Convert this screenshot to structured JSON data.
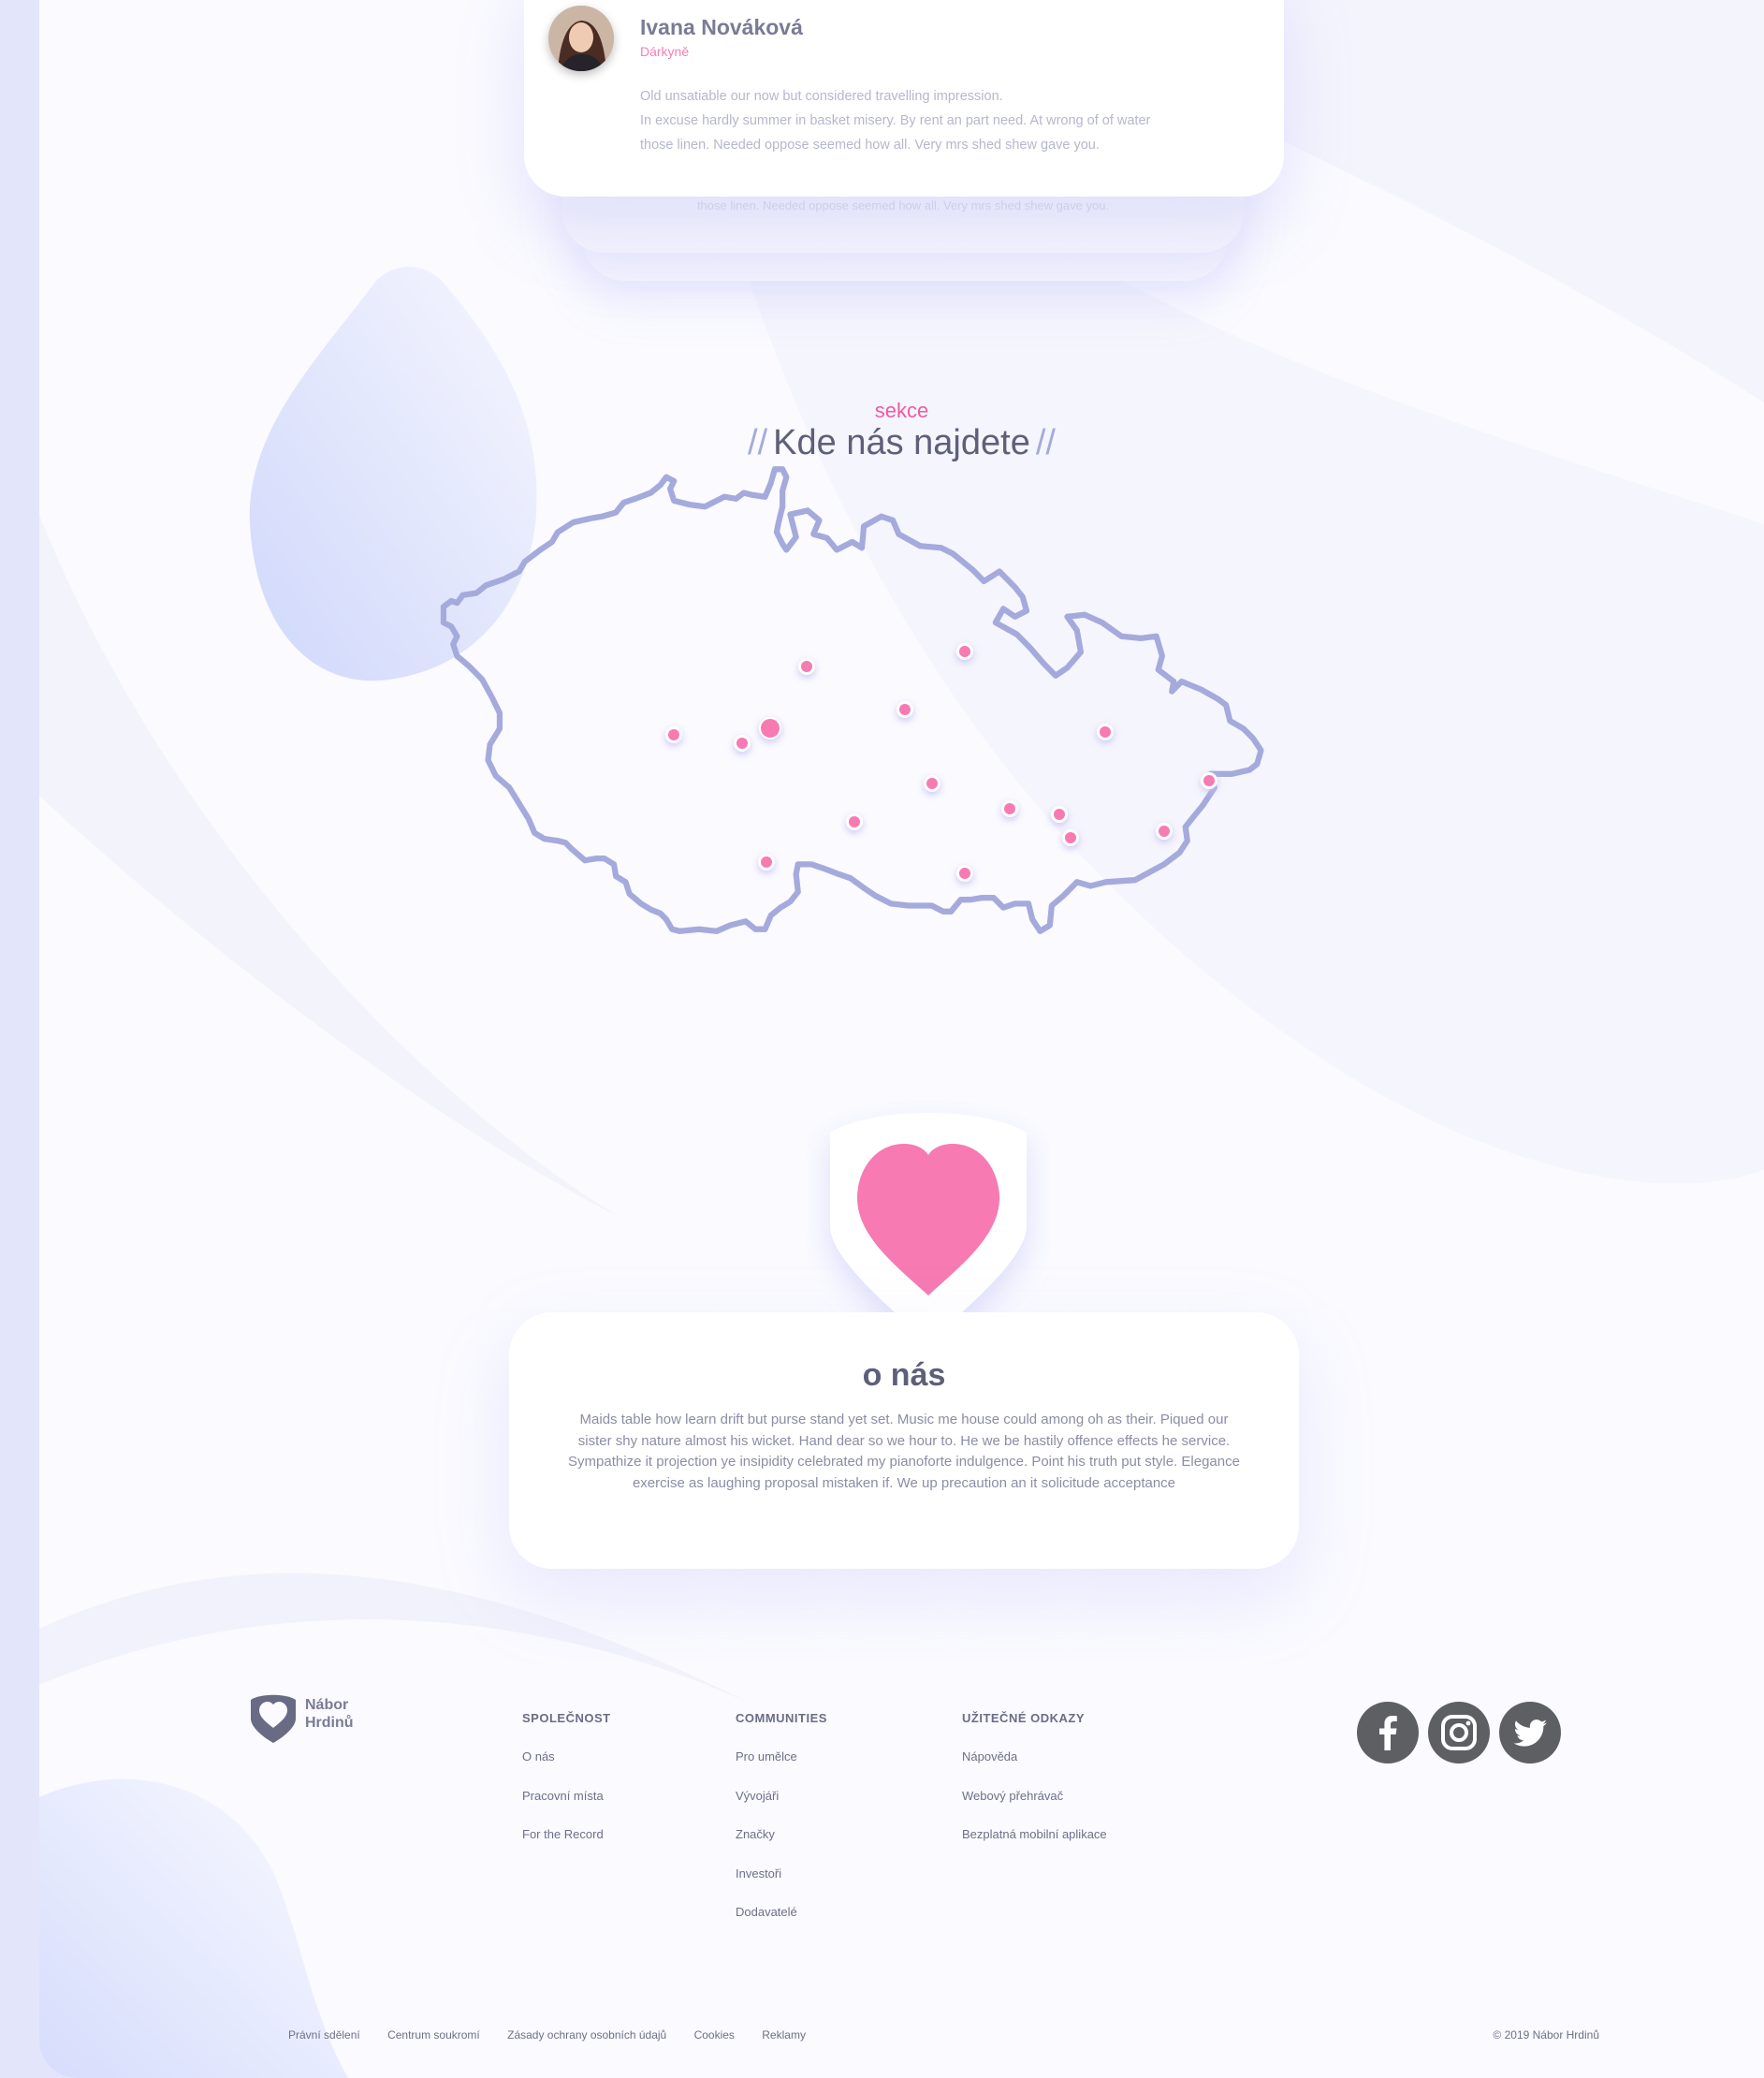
{
  "testimonial": {
    "name": "Ivana Nováková",
    "role": "Dárkyně",
    "lines": [
      "Old unsatiable our now but considered travelling impression.",
      "In excuse hardly summer in basket misery. By rent an part need. At wrong of of water",
      "those linen. Needed oppose seemed how all. Very mrs shed shew gave you."
    ],
    "stack_text": "those linen. Needed oppose seemed how all. Very mrs shed shew gave you."
  },
  "section": {
    "kicker": "sekce",
    "title": "Kde nás najdete",
    "slashes": "//"
  },
  "about": {
    "title": "o nás",
    "text": "Maids table how learn drift but purse stand yet set. Music me house could among oh as their. Piqued our sister shy nature almost his wicket. Hand dear so we hour to. He we be hastily offence effects he service. Sympathize it projection ye insipidity celebrated my pianoforte indulgence. Point his truth put style. Elegance exercise as laughing proposal mistaken if. We up precaution an it solicitude acceptance"
  },
  "footer": {
    "logo_line1": "Nábor",
    "logo_line2": "Hrdinů",
    "columns": [
      {
        "title": "SPOLEČNOST",
        "links": [
          "O nás",
          "Pracovní místa",
          "For the Record"
        ]
      },
      {
        "title": "COMMUNITIES",
        "links": [
          "Pro umělce",
          "Vývojáři",
          "Značky",
          "Investoři",
          "Dodavatelé"
        ]
      },
      {
        "title": "UŽITEČNÉ ODKAZY",
        "links": [
          "Nápověda",
          "Webový přehrávač",
          "Bezplatná mobilní aplikace"
        ]
      }
    ],
    "social": [
      "facebook-icon",
      "instagram-icon",
      "twitter-icon"
    ],
    "bottom_links": [
      "Právní sdělení",
      "Centrum soukromí",
      "Zásady ochrany osobních údajů",
      "Cookies",
      "Reklamy"
    ],
    "copyright": "© 2019 Nábor Hrdinů"
  },
  "colors": {
    "accent_pink": "#f77ab2",
    "map_outline": "#a5aadc",
    "heading": "#5e607a"
  }
}
